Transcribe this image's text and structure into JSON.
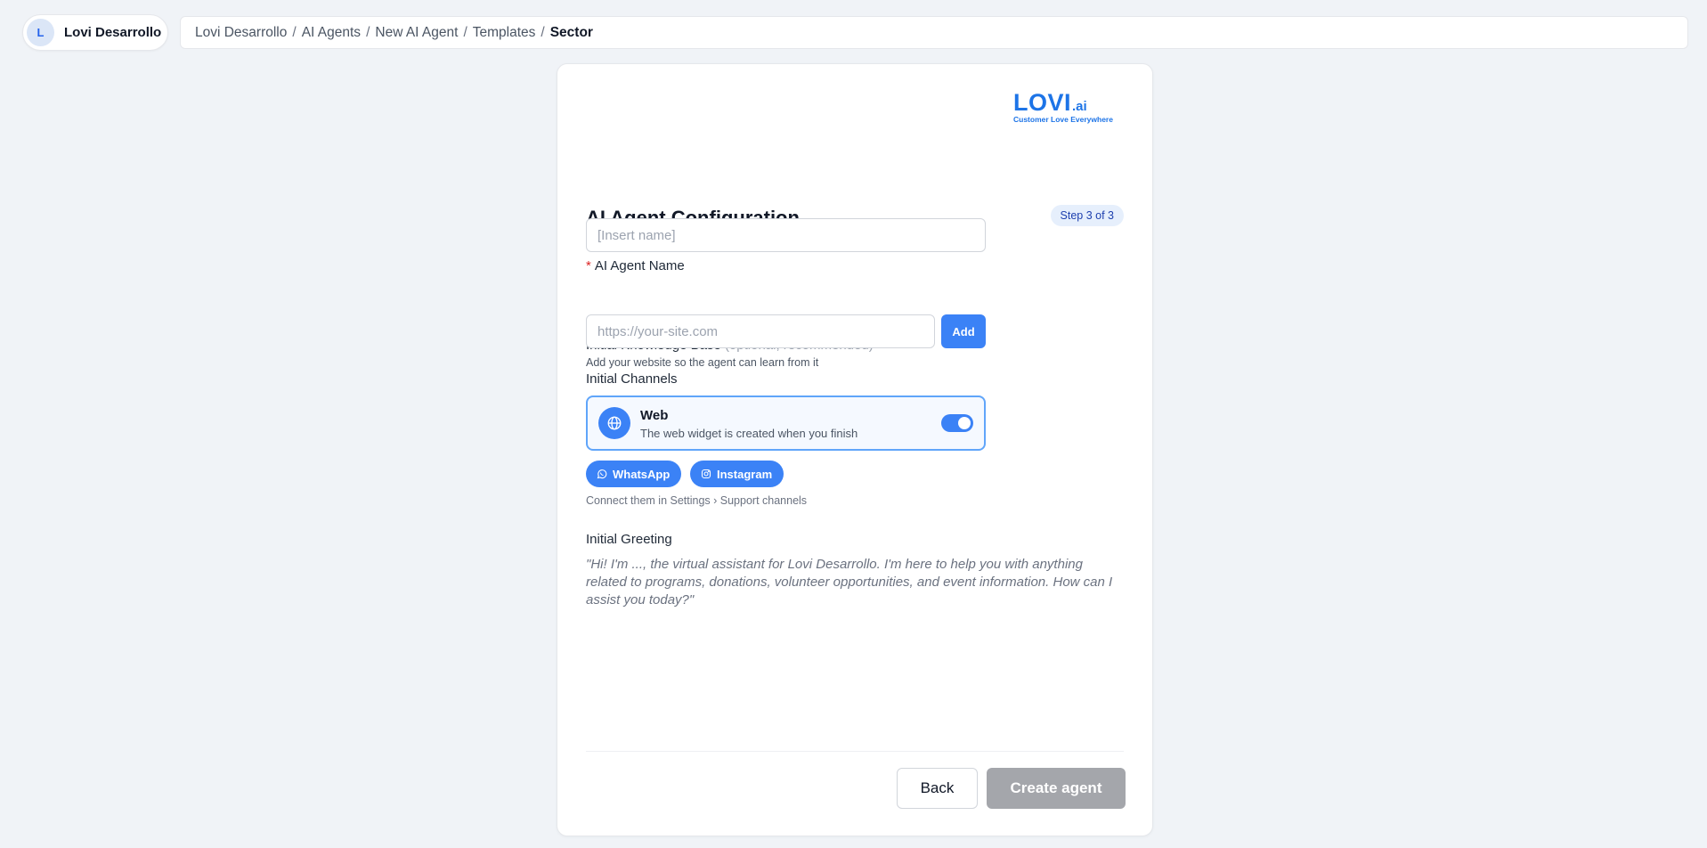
{
  "org": {
    "initial": "L",
    "name": "Lovi Desarrollo"
  },
  "breadcrumb": {
    "items": [
      "Lovi Desarrollo",
      "AI Agents",
      "New AI Agent",
      "Templates"
    ],
    "current": "Sector",
    "separator": "/"
  },
  "logo": {
    "word": "LOVI",
    "suffix": ".ai",
    "tagline": "Customer Love Everywhere"
  },
  "form": {
    "title": "AI Agent Configuration",
    "step": "Step 3 of 3",
    "name_field": {
      "required_mark": "*",
      "label": "AI Agent Name",
      "placeholder": "[Insert name]",
      "value": ""
    },
    "knowledge_base": {
      "label": "Initial Knowledge Base",
      "label_hint": "(optional, recommended)",
      "help": "Add your website so the agent can learn from it",
      "placeholder": "https://your-site.com",
      "value": "",
      "add_label": "Add"
    },
    "channels": {
      "label": "Initial Channels",
      "web": {
        "name": "Web",
        "description": "The web widget is created when you finish",
        "enabled": true,
        "icon": "globe-icon"
      },
      "extra": [
        {
          "name": "WhatsApp",
          "icon": "whatsapp-icon"
        },
        {
          "name": "Instagram",
          "icon": "instagram-icon"
        }
      ],
      "note": "Connect them in Settings › Support channels"
    },
    "greeting": {
      "label": "Initial Greeting",
      "text": "\"Hi! I'm ..., the virtual assistant for Lovi Desarrollo. I'm here to help you with anything related to programs, donations, volunteer opportunities, and event information. How can I assist you today?\""
    },
    "actions": {
      "back_label": "Back",
      "create_label": "Create agent",
      "create_enabled": false
    }
  },
  "colors": {
    "accent": "#3b82f6",
    "brand": "#1d74e7",
    "background": "#f0f3f7",
    "required": "#dc2626",
    "disabled_button": "#a4a6ab"
  }
}
